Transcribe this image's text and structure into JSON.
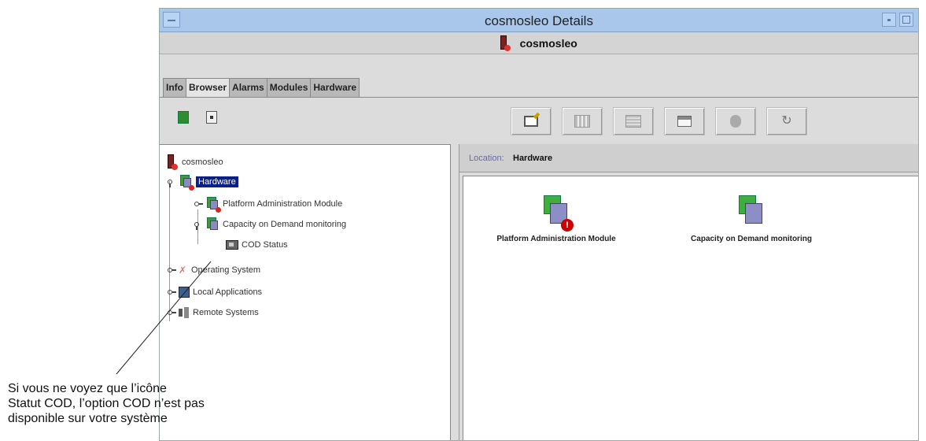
{
  "window": {
    "title": "cosmosleo Details",
    "hostname": "cosmosleo"
  },
  "tabs": [
    "Info",
    "Browser",
    "Alarms",
    "Modules",
    "Hardware"
  ],
  "active_tab": "Browser",
  "tree": {
    "root": "cosmosleo",
    "hardware": "Hardware",
    "pam": "Platform Administration Module",
    "cod_monitor": "Capacity on Demand monitoring",
    "cod_status": "COD Status",
    "os": "Operating System",
    "local_apps": "Local Applications",
    "remote": "Remote Systems"
  },
  "location": {
    "label": "Location:",
    "value": "Hardware"
  },
  "content_items": [
    {
      "label": "Platform Administration Module",
      "icon": "hardware-module-alert-icon",
      "alert": "!"
    },
    {
      "label": "Capacity on Demand monitoring",
      "icon": "hardware-module-icon"
    }
  ],
  "annotation": {
    "line1": "Si vous ne voyez que l’icône",
    "line2": "Statut COD, l’option COD n’est pas",
    "line3": "disponible sur votre système"
  },
  "colors": {
    "titlebar": "#a9c7ea",
    "selection": "#0b1f8a",
    "alert": "#cc0000"
  }
}
